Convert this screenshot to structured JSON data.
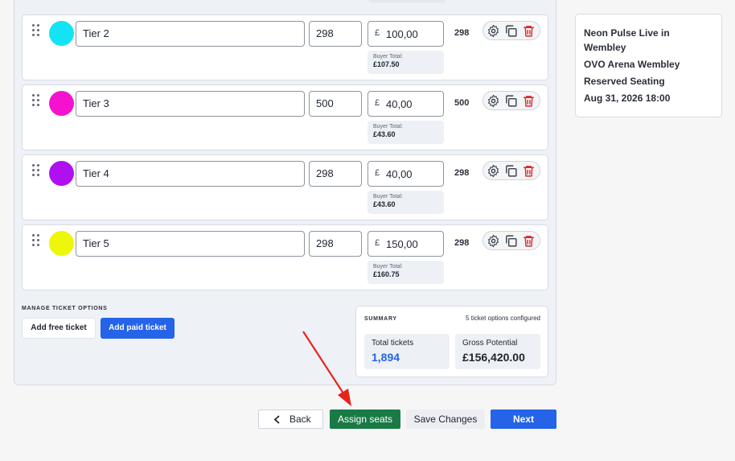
{
  "tiers": [
    {
      "name": "Tier 2",
      "color": "#14e3f3",
      "quantity": "298",
      "currency": "£",
      "price": "100,00",
      "buyer_total_label": "Buyer Total:",
      "buyer_total": "£107.50",
      "count": "298"
    },
    {
      "name": "Tier 3",
      "color": "#f412cf",
      "quantity": "500",
      "currency": "£",
      "price": "40,00",
      "buyer_total_label": "Buyer Total:",
      "buyer_total": "£43.60",
      "count": "500"
    },
    {
      "name": "Tier 4",
      "color": "#b00ff2",
      "quantity": "298",
      "currency": "£",
      "price": "40,00",
      "buyer_total_label": "Buyer Total:",
      "buyer_total": "£43.60",
      "count": "298"
    },
    {
      "name": "Tier 5",
      "color": "#eef708",
      "quantity": "298",
      "currency": "£",
      "price": "150,00",
      "buyer_total_label": "Buyer Total:",
      "buyer_total": "£160.75",
      "count": "298"
    }
  ],
  "manage": {
    "title": "MANAGE TICKET OPTIONS",
    "add_free": "Add free ticket",
    "add_paid": "Add paid ticket"
  },
  "summary": {
    "title": "SUMMARY",
    "configured": "5 ticket options configured",
    "total_label": "Total tickets",
    "total_value": "1,894",
    "gross_label": "Gross Potential",
    "gross_value": "£156,420.00"
  },
  "event": {
    "name": "Neon Pulse Live in Wembley",
    "venue": "OVO Arena Wembley",
    "seating": "Reserved Seating",
    "datetime": "Aug 31, 2026 18:00"
  },
  "nav": {
    "back": "Back",
    "assign": "Assign seats",
    "save": "Save Changes",
    "next": "Next"
  },
  "colors": {
    "primary": "#2563e8",
    "assign": "#1a7a46",
    "delete": "#d62b2b",
    "total_value": "#2563e8",
    "annotation_arrow": "#e8231c"
  },
  "icons": [
    "drag-handle-icon",
    "gear-icon",
    "copy-icon",
    "trash-icon",
    "chevron-left-icon"
  ]
}
